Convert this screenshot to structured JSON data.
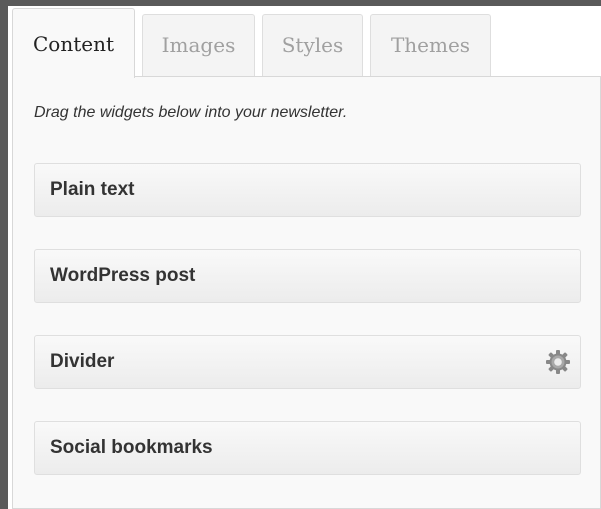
{
  "tabs": [
    {
      "label": "Content",
      "active": true
    },
    {
      "label": "Images",
      "active": false
    },
    {
      "label": "Styles",
      "active": false
    },
    {
      "label": "Themes",
      "active": false
    }
  ],
  "panel": {
    "instruction": "Drag the widgets below into your newsletter."
  },
  "widgets": [
    {
      "label": "Plain text",
      "has_settings": false
    },
    {
      "label": "WordPress post",
      "has_settings": false
    },
    {
      "label": "Divider",
      "has_settings": true,
      "settings_icon": "gear-icon"
    },
    {
      "label": "Social bookmarks",
      "has_settings": false
    }
  ],
  "colors": {
    "background": "#5a5a5a",
    "panel": "#f9f9f9",
    "border": "#d8d8d8",
    "active_tab_text": "#222222",
    "inactive_tab_text": "#a0a0a0"
  }
}
